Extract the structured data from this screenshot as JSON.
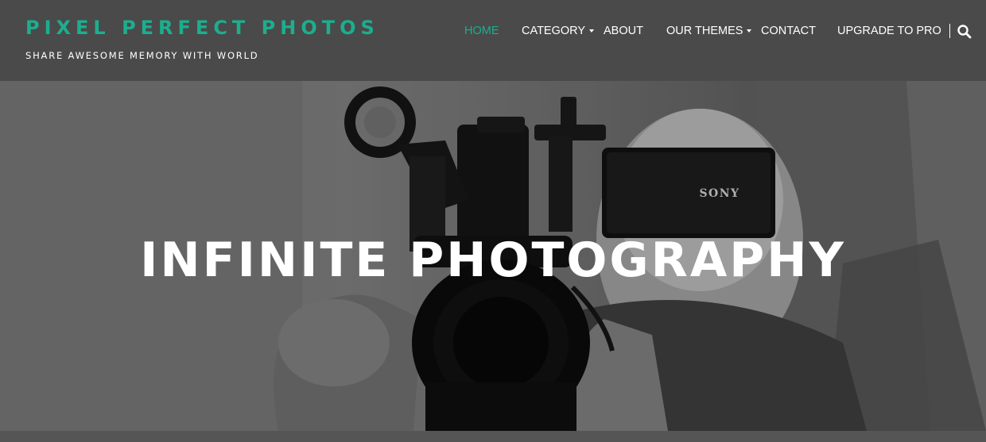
{
  "site": {
    "title": "PIXEL PERFECT PHOTOS",
    "tagline": "SHARE AWESOME MEMORY WITH WORLD"
  },
  "nav": {
    "items": [
      {
        "label": "HOME",
        "active": true,
        "has_dropdown": false
      },
      {
        "label": "CATEGORY",
        "active": false,
        "has_dropdown": true
      },
      {
        "label": "ABOUT",
        "active": false,
        "has_dropdown": false
      },
      {
        "label": "OUR THEMES",
        "active": false,
        "has_dropdown": true
      },
      {
        "label": "CONTACT",
        "active": false,
        "has_dropdown": false
      },
      {
        "label": "UPGRADE TO PRO",
        "active": false,
        "has_dropdown": false
      }
    ],
    "search_icon": "search-icon"
  },
  "hero": {
    "title": "INFINITE PHOTOGRAPHY",
    "camera_brand": "SONY"
  },
  "colors": {
    "accent": "#1cae8d",
    "header_bg": "#4a4a4a",
    "text": "#ffffff"
  }
}
